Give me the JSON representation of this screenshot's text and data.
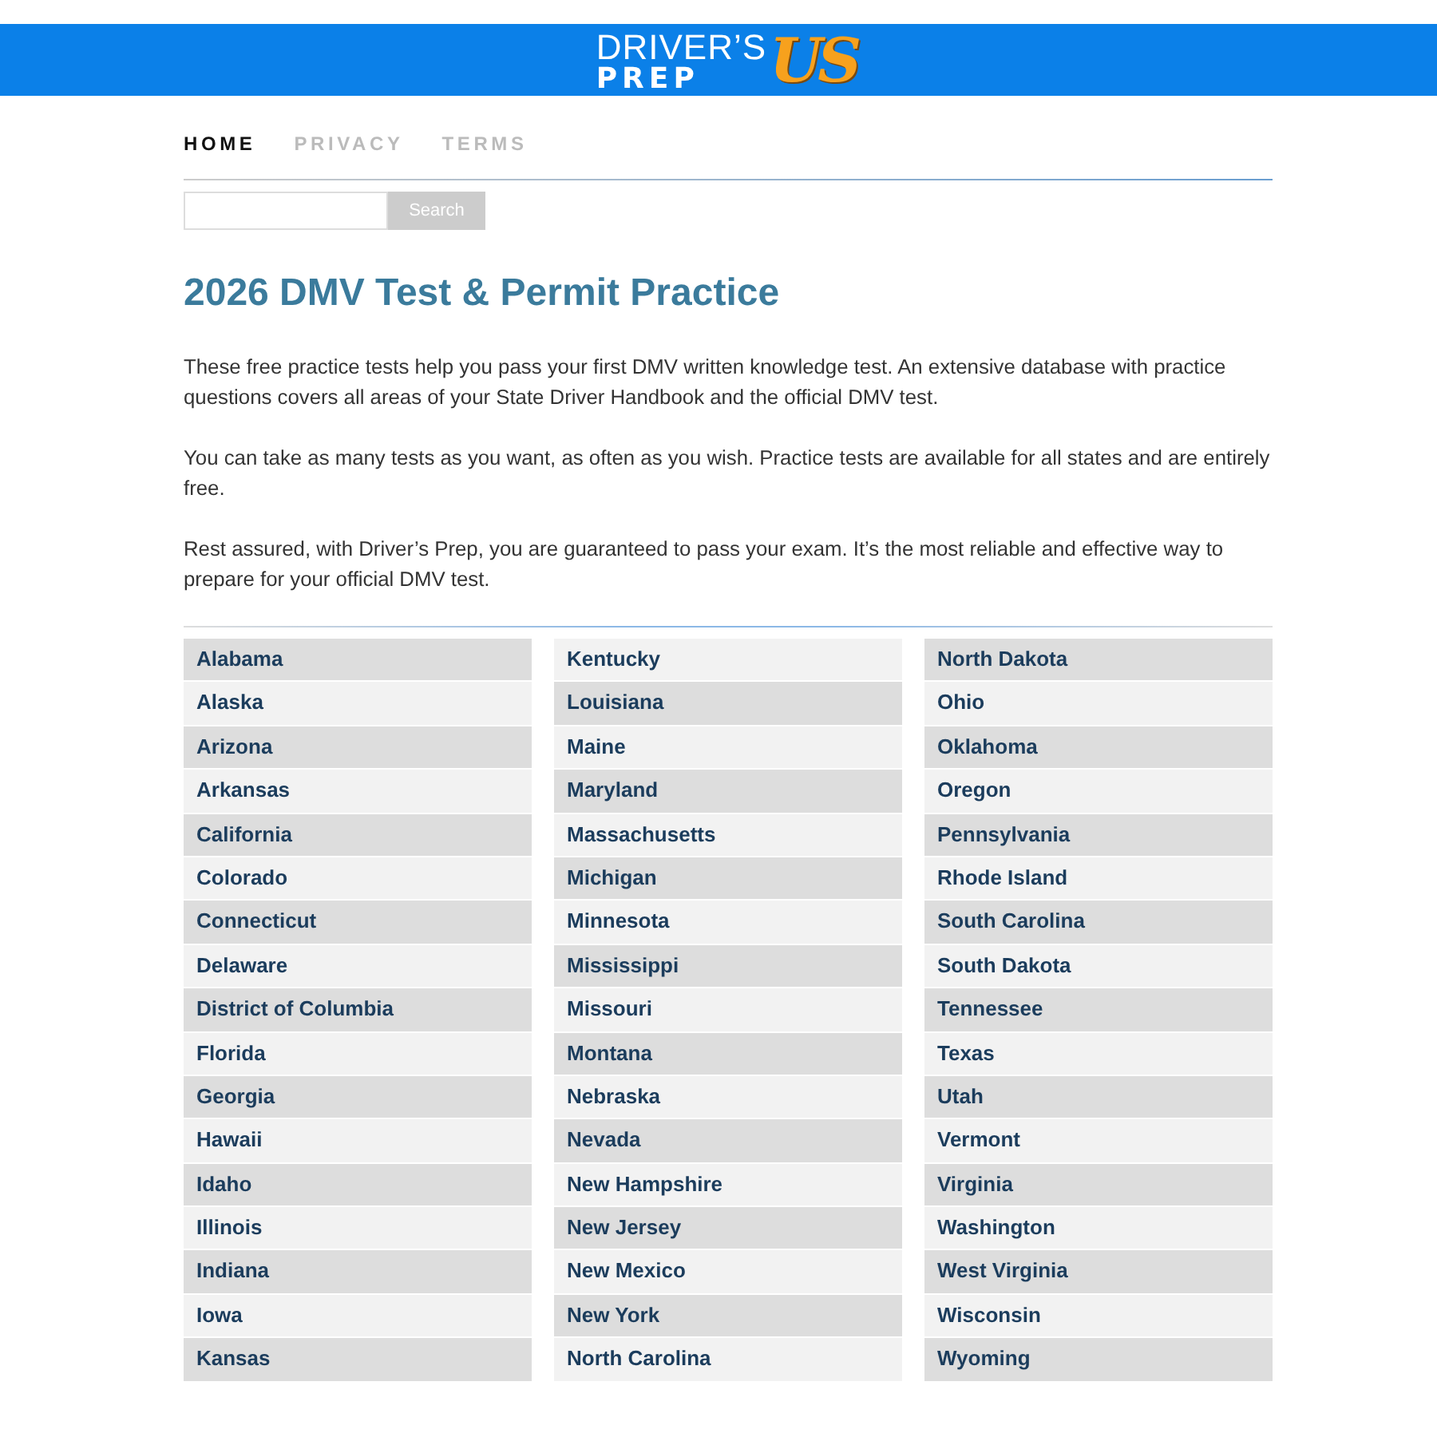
{
  "header": {
    "logo": {
      "line_1": "DRIVER’S",
      "line_2": "PREP",
      "mark": "US"
    }
  },
  "nav": [
    {
      "label": "HOME",
      "selected": true
    },
    {
      "label": "PRIVACY",
      "selected": false
    },
    {
      "label": "TERMS",
      "selected": false
    }
  ],
  "search": {
    "button": "Search"
  },
  "title": "2026 DMV Test & Permit Practice",
  "paragraphs": [
    "These free practice tests help you pass your first DMV written knowledge test. An extensive database with practice questions covers all areas of your State Driver Handbook and the official DMV test.",
    "You can take as many tests as you want, as often as you wish. Practice tests are available for all states and are entirely free.",
    "Rest assured, with Driver’s Prep, you are guaranteed to pass your exam. It’s the most reliable and effective way to prepare for your official DMV test."
  ],
  "states": [
    [
      "Alabama",
      "Alaska",
      "Arizona",
      "Arkansas",
      "California",
      "Colorado",
      "Connecticut",
      "Delaware",
      "District of Columbia",
      "Florida",
      "Georgia",
      "Hawaii",
      "Idaho",
      "Illinois",
      "Indiana",
      "Iowa",
      "Kansas"
    ],
    [
      "Kentucky",
      "Louisiana",
      "Maine",
      "Maryland",
      "Massachusetts",
      "Michigan",
      "Minnesota",
      "Mississippi",
      "Missouri",
      "Montana",
      "Nebraska",
      "Nevada",
      "New Hampshire",
      "New Jersey",
      "New Mexico",
      "New York",
      "North Carolina"
    ],
    [
      "North Dakota",
      "Ohio",
      "Oklahoma",
      "Oregon",
      "Pennsylvania",
      "Rhode Island",
      "South Carolina",
      "South Dakota",
      "Tennessee",
      "Texas",
      "Utah",
      "Vermont",
      "Virginia",
      "Washington",
      "West Virginia",
      "Wisconsin",
      "Wyoming"
    ]
  ]
}
